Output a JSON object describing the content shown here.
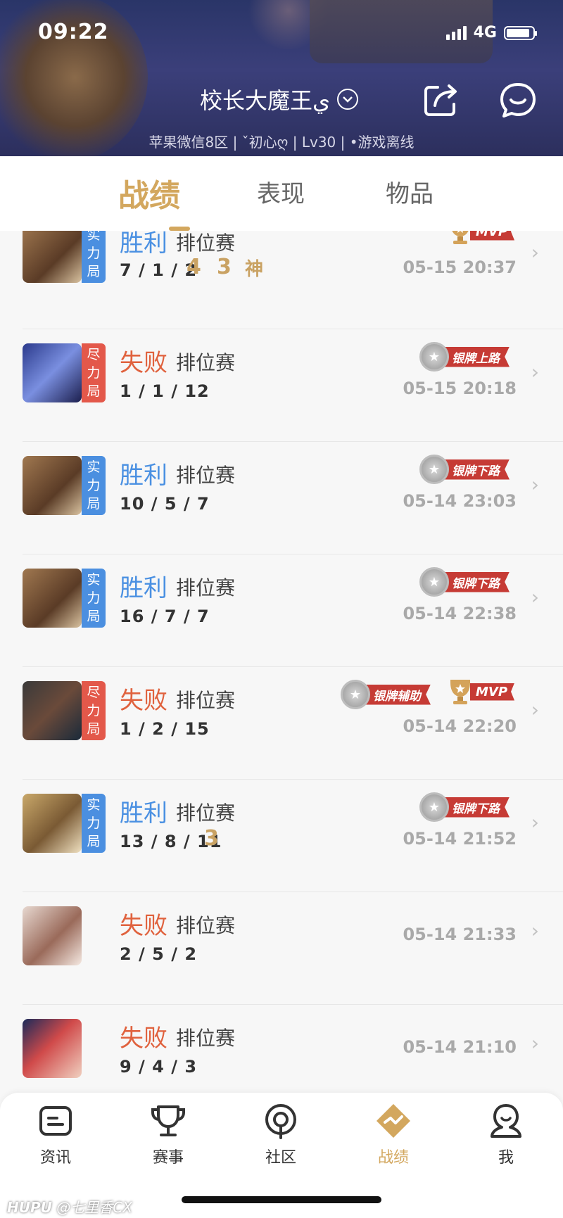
{
  "status_bar": {
    "time": "09:22",
    "network": "4G"
  },
  "profile": {
    "name": "校长大魔王ي",
    "subinfo": "苹果微信8区 | ˇ初心ღ | Lv30 | •游戏离线",
    "icons": [
      "chevron-down-icon",
      "share-icon",
      "chat-icon"
    ]
  },
  "tabs": [
    {
      "label": "战绩",
      "active": true
    },
    {
      "label": "表现",
      "active": false
    },
    {
      "label": "物品",
      "active": false
    }
  ],
  "matches": [
    {
      "result": "胜利",
      "mode": "排位赛",
      "kda": "7 / 1 / 2",
      "tag": [
        "实",
        "力",
        "局"
      ],
      "tag_color": "blue",
      "time": "05-15 20:37",
      "achievements": [
        "4",
        "3",
        "神"
      ],
      "badges": [
        {
          "type": "mvp",
          "label": "MVP"
        }
      ]
    },
    {
      "result": "失败",
      "mode": "排位赛",
      "kda": "1 / 1 / 12",
      "tag": [
        "尽",
        "力",
        "局"
      ],
      "tag_color": "red",
      "time": "05-15 20:18",
      "achievements": [],
      "badges": [
        {
          "type": "silver",
          "label": "银牌上路"
        }
      ]
    },
    {
      "result": "胜利",
      "mode": "排位赛",
      "kda": "10 / 5 / 7",
      "tag": [
        "实",
        "力",
        "局"
      ],
      "tag_color": "blue",
      "time": "05-14 23:03",
      "achievements": [],
      "badges": [
        {
          "type": "silver",
          "label": "银牌下路"
        }
      ]
    },
    {
      "result": "胜利",
      "mode": "排位赛",
      "kda": "16 / 7 / 7",
      "tag": [
        "实",
        "力",
        "局"
      ],
      "tag_color": "blue",
      "time": "05-14 22:38",
      "achievements": [],
      "badges": [
        {
          "type": "silver",
          "label": "银牌下路"
        }
      ]
    },
    {
      "result": "失败",
      "mode": "排位赛",
      "kda": "1 / 2 / 15",
      "tag": [
        "尽",
        "力",
        "局"
      ],
      "tag_color": "red",
      "time": "05-14 22:20",
      "achievements": [],
      "badges": [
        {
          "type": "silver",
          "label": "银牌辅助"
        },
        {
          "type": "mvp",
          "label": "MVP"
        }
      ]
    },
    {
      "result": "胜利",
      "mode": "排位赛",
      "kda": "13 / 8 / 11",
      "tag": [
        "实",
        "力",
        "局"
      ],
      "tag_color": "blue",
      "time": "05-14 21:52",
      "achievements": [
        "3"
      ],
      "badges": [
        {
          "type": "silver",
          "label": "银牌下路"
        }
      ]
    },
    {
      "result": "失败",
      "mode": "排位赛",
      "kda": "2 / 5 / 2",
      "tag": [],
      "tag_color": "",
      "time": "05-14 21:33",
      "achievements": [],
      "badges": []
    },
    {
      "result": "失败",
      "mode": "排位赛",
      "kda": "9 / 4 / 3",
      "tag": [],
      "tag_color": "",
      "time": "05-14 21:10",
      "achievements": [],
      "badges": []
    }
  ],
  "bottom_nav": [
    {
      "label": "资讯",
      "icon": "news-icon",
      "active": false
    },
    {
      "label": "赛事",
      "icon": "trophy-icon",
      "active": false
    },
    {
      "label": "社区",
      "icon": "community-icon",
      "active": false
    },
    {
      "label": "战绩",
      "icon": "stats-icon",
      "active": true
    },
    {
      "label": "我",
      "icon": "profile-icon",
      "active": false
    }
  ],
  "watermark": {
    "brand": "HUPU",
    "text": "@七里香CX"
  },
  "colors": {
    "accent": "#d3a75e",
    "win": "#4a90e2",
    "loss": "#e0623e",
    "badge_red": "#c63b35"
  }
}
